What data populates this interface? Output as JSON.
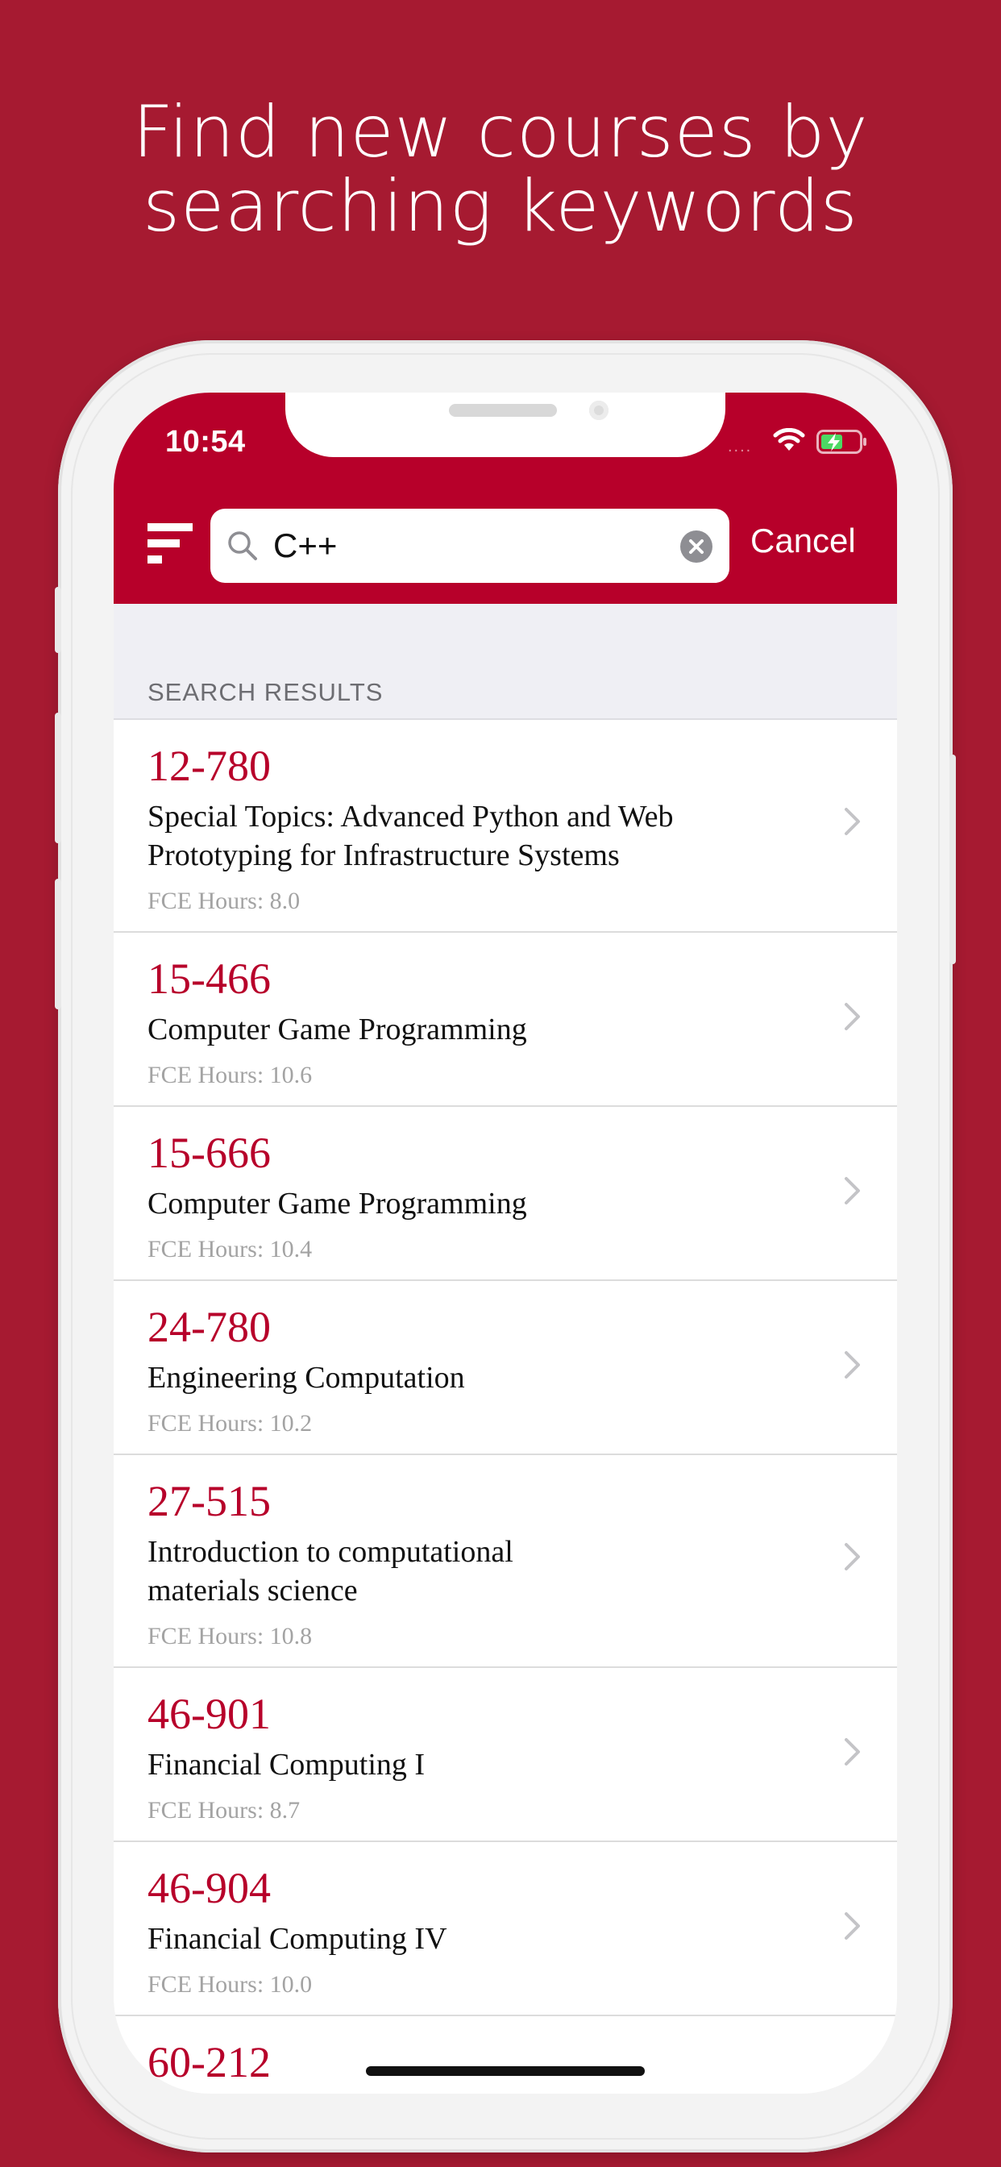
{
  "headline": {
    "line1": "Find new courses by",
    "line2": "searching keywords"
  },
  "status_bar": {
    "time": "10:54",
    "signal_dots": "....",
    "battery_color": "#4cd964"
  },
  "colors": {
    "background": "#a61a31",
    "header": "#b7002a",
    "accent": "#b7002a"
  },
  "search": {
    "value": "C++",
    "cancel_label": "Cancel"
  },
  "section": {
    "label": "SEARCH RESULTS"
  },
  "results": [
    {
      "code": "12-780",
      "title": "Special Topics: Advanced Python and Web Prototyping for Infrastructure Systems",
      "hours": "FCE Hours: 8.0"
    },
    {
      "code": "15-466",
      "title": "Computer Game Programming",
      "hours": "FCE Hours: 10.6"
    },
    {
      "code": "15-666",
      "title": "Computer Game Programming",
      "hours": "FCE Hours: 10.4"
    },
    {
      "code": "24-780",
      "title": "Engineering Computation",
      "hours": "FCE Hours: 10.2"
    },
    {
      "code": "27-515",
      "title": "Introduction to computational materials science",
      "hours": "FCE Hours: 10.8"
    },
    {
      "code": "46-901",
      "title": "Financial Computing I",
      "hours": "FCE Hours: 8.7"
    },
    {
      "code": "46-904",
      "title": "Financial Computing IV",
      "hours": "FCE Hours: 10.0"
    },
    {
      "code": "60-212",
      "title": "",
      "hours": ""
    }
  ],
  "icons": {
    "menu": "menu-icon",
    "search": "search-icon",
    "clear": "clear-icon",
    "chevron": "chevron-right-icon",
    "wifi": "wifi-icon",
    "battery": "battery-icon"
  }
}
